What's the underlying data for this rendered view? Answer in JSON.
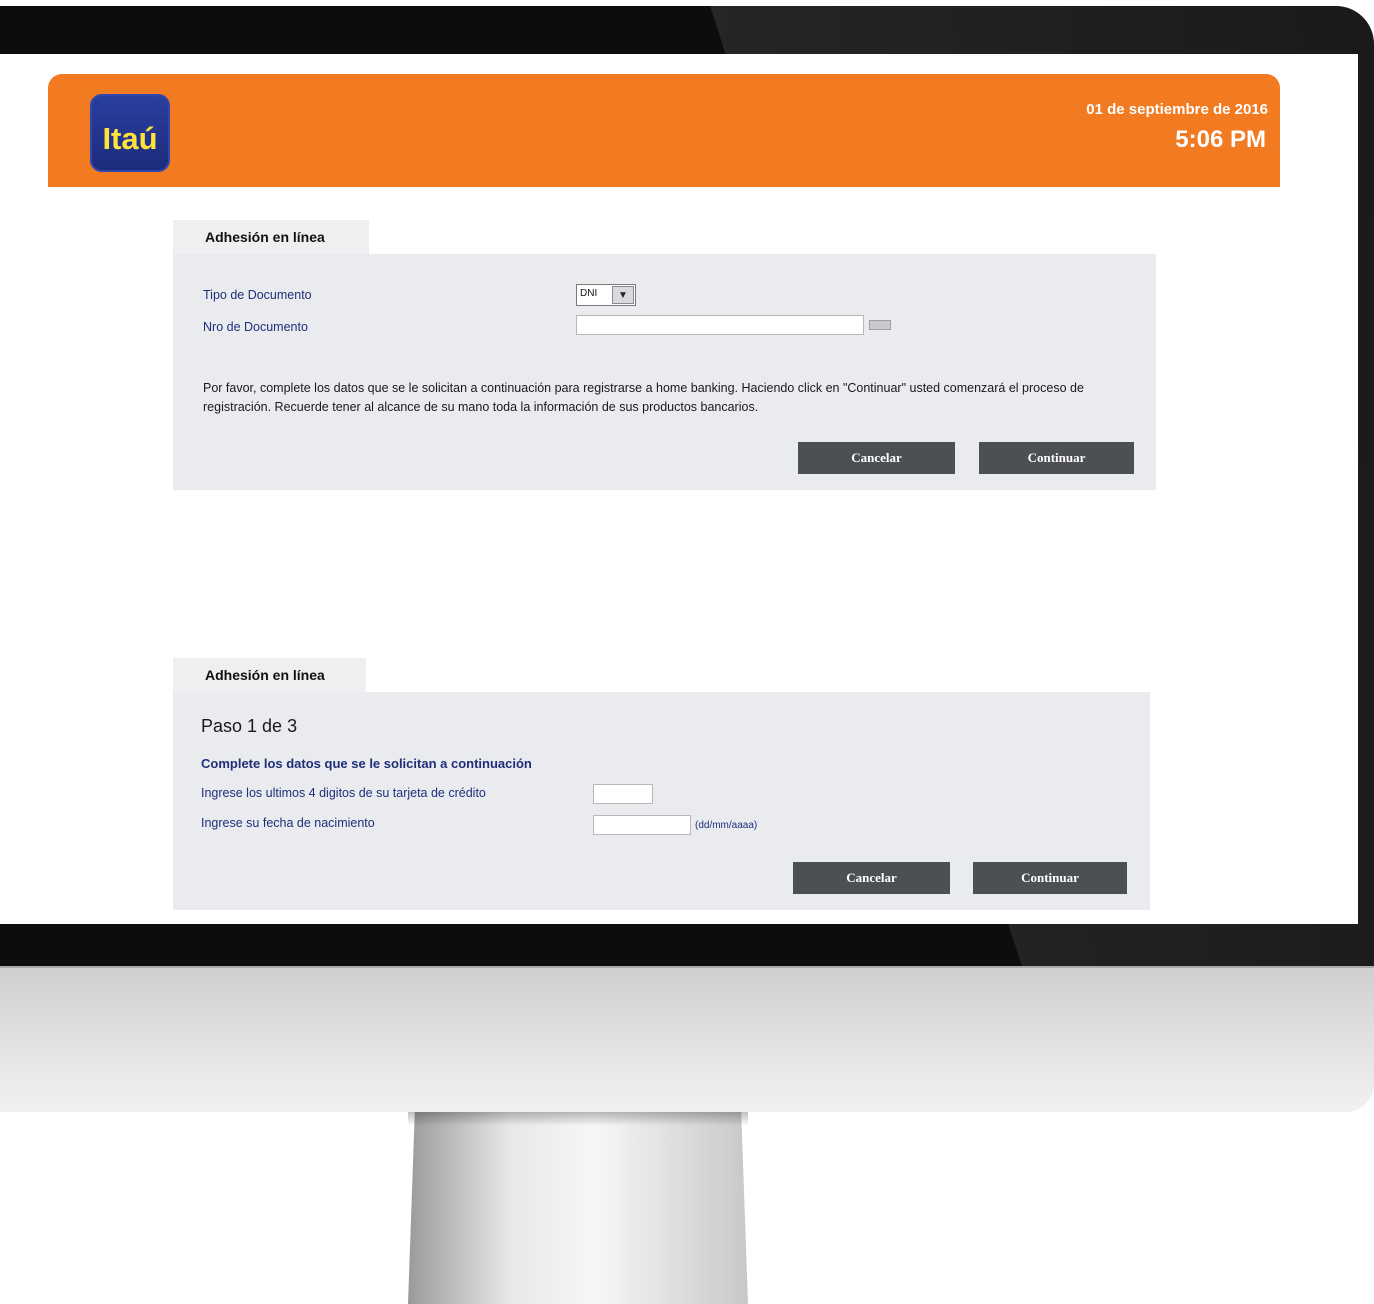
{
  "header": {
    "logo_text": "Itaú",
    "date": "01 de septiembre de 2016",
    "time": "5:06 PM"
  },
  "panel1": {
    "tab_label": "Adhesión en línea",
    "tipo_label": "Tipo de Documento",
    "tipo_value": "DNI",
    "nro_label": "Nro de Documento",
    "nro_value": "",
    "description": "Por favor, complete los datos que se le solicitan a continuación para registrarse a home banking. Haciendo click en \"Continuar\" usted comenzará el proceso de registración. Recuerde tener al alcance de su mano toda la información de sus productos bancarios.",
    "cancel_label": "Cancelar",
    "continue_label": "Continuar"
  },
  "panel2": {
    "tab_label": "Adhesión en línea",
    "step": "Paso 1 de 3",
    "subheading": "Complete los datos que se le solicitan a continuación",
    "card_label": "Ingrese los ultimos 4 digitos de su tarjeta de crédito",
    "card_value": "",
    "birth_label": "Ingrese su fecha de nacimiento",
    "birth_value": "",
    "birth_hint": "(dd/mm/aaaa)",
    "cancel_label": "Cancelar",
    "continue_label": "Continuar"
  }
}
